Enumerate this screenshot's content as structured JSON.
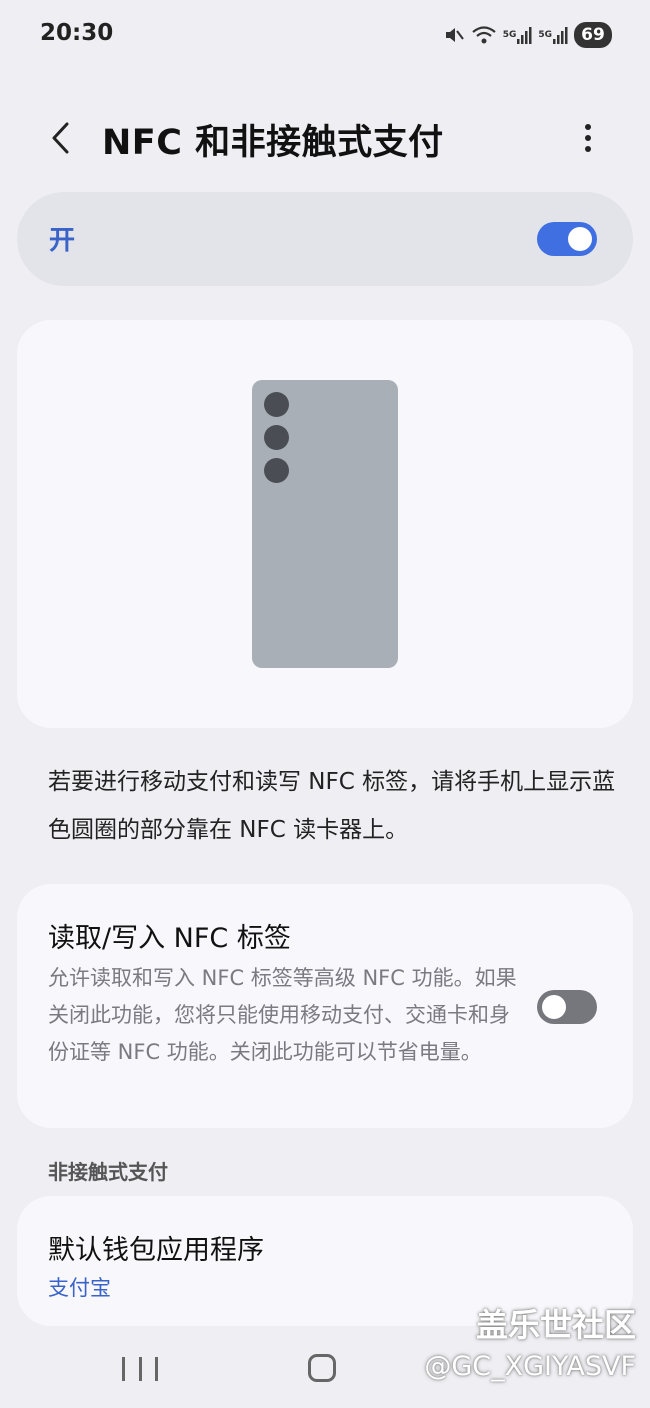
{
  "status_bar": {
    "time": "20:30",
    "icons": [
      "mute-icon",
      "wifi-icon",
      "signal-icon",
      "signal-icon"
    ],
    "network_label_1": "5G",
    "network_label_2": "5G",
    "battery": "69"
  },
  "header": {
    "title": "NFC 和非接触式支付"
  },
  "master_toggle": {
    "label": "开",
    "state": true
  },
  "description": "若要进行移动支付和读写 NFC 标签，请将手机上显示蓝色圆圈的部分靠在 NFC 读卡器上。",
  "nfc_tag": {
    "title": "读取/写入 NFC 标签",
    "description": "允许读取和写入 NFC 标签等高级 NFC 功能。如果关闭此功能，您将只能使用移动支付、交通卡和身份证等 NFC 功能。关闭此功能可以节省电量。",
    "state": false
  },
  "contactless_section": {
    "header": "非接触式支付",
    "wallet": {
      "title": "默认钱包应用程序",
      "value": "支付宝"
    }
  },
  "watermark": {
    "site": "盖乐世社区",
    "user": "@GC_XGIYASVF"
  },
  "colors": {
    "accent": "#3f6fe0",
    "link": "#3a63c8",
    "background": "#eeeef3",
    "card": "#f8f8fc"
  }
}
